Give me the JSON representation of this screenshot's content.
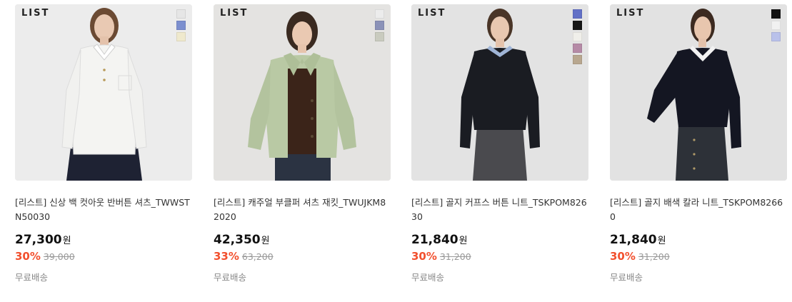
{
  "products": [
    {
      "brand_logo": "LIST",
      "swatches": [
        "#e6e6e6",
        "#7c8fcf",
        "#efe9cd"
      ],
      "title": "[리스트] 신상 백 컷아웃 반버튼 셔츠_TWWSTN50030",
      "price": "27,300",
      "currency": "원",
      "discount_rate": "30%",
      "original_price": "39,000",
      "shipping": "무료배송",
      "garment_color": "#f4f4f2",
      "bottom_color": "#1e2233"
    },
    {
      "brand_logo": "LIST",
      "swatches": [
        "#ececec",
        "#8b92b8",
        "#c9cbbf"
      ],
      "title": "[리스트] 캐주얼 부클퍼 셔츠 재킷_TWUJKM82020",
      "price": "42,350",
      "currency": "원",
      "discount_rate": "33%",
      "original_price": "63,200",
      "shipping": "무료배송",
      "garment_color": "#b9c9a4",
      "bottom_color": "#2b3342"
    },
    {
      "brand_logo": "LIST",
      "swatches": [
        "#6270c6",
        "#151515",
        "#f0efea",
        "#b58aa6",
        "#b8a78f"
      ],
      "title": "[리스트] 골지 커프스 버튼 니트_TSKPOM82630",
      "price": "21,840",
      "currency": "원",
      "discount_rate": "30%",
      "original_price": "31,200",
      "shipping": "무료배송",
      "garment_color": "#1a1c22",
      "bottom_color": "#4a4a4e"
    },
    {
      "brand_logo": "LIST",
      "swatches": [
        "#121212",
        "#f1f1f1",
        "#b9c1ea"
      ],
      "title": "[리스트] 골지 배색 칼라 니트_TSKPOM82660",
      "price": "21,840",
      "currency": "원",
      "discount_rate": "30%",
      "original_price": "31,200",
      "shipping": "무료배송",
      "garment_color": "#141622",
      "bottom_color": "#2d3138"
    }
  ]
}
